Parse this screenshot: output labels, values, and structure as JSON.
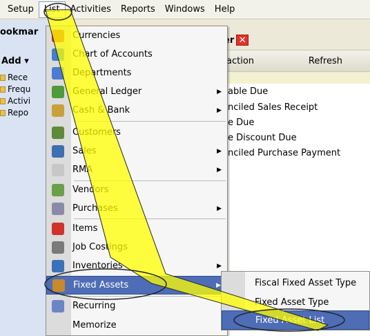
{
  "menubar": {
    "items": [
      {
        "label": "Setup"
      },
      {
        "label": "List"
      },
      {
        "label": "Activities"
      },
      {
        "label": "Reports"
      },
      {
        "label": "Windows"
      },
      {
        "label": "Help"
      }
    ],
    "active_index": 1
  },
  "bookmarks": {
    "title": "ookmar",
    "add_label": "Add ▾",
    "items": [
      "Rece",
      "Frequ",
      "Activi",
      "Repo"
    ]
  },
  "right_panel": {
    "title": "er",
    "close_glyph": "✕",
    "toolbar": [
      "action",
      "Refresh"
    ],
    "lines": [
      "able Due",
      "nciled Sales Receipt",
      "e Due",
      "e Discount Due",
      "nciled Purchase Payment"
    ]
  },
  "list_menu": {
    "items": [
      {
        "label": "Currencies",
        "icon": "currency-icon",
        "color": "#d33b2c"
      },
      {
        "label": "Chart of Accounts",
        "icon": "chart-of-accounts-icon",
        "color": "#3f7fce"
      },
      {
        "label": "Departments",
        "icon": "departments-icon",
        "color": "#4b7bd3"
      },
      {
        "label": "General Ledger",
        "icon": "general-ledger-icon",
        "color": "#4f9a3a",
        "submenu": true
      },
      {
        "label": "Cash & Bank",
        "icon": "cash-bank-icon",
        "color": "#c9a13a",
        "submenu": true
      },
      {
        "label": "Customers",
        "icon": "customers-icon",
        "color": "#5f8a3c"
      },
      {
        "label": "Sales",
        "icon": "sales-icon",
        "color": "#3f6fb0",
        "submenu": true
      },
      {
        "label": "RMA",
        "icon": "rma-icon",
        "color": "#c7c7c7",
        "submenu": true
      },
      {
        "label": "Vendors",
        "icon": "vendors-icon",
        "color": "#6aa048"
      },
      {
        "label": "Purchases",
        "icon": "purchases-icon",
        "color": "#8a8aa8",
        "submenu": true
      },
      {
        "label": "Items",
        "icon": "items-icon",
        "color": "#d0332a"
      },
      {
        "label": "Job Costings",
        "icon": "job-costings-icon",
        "color": "#7a7a7a"
      },
      {
        "label": "Inventories",
        "icon": "inventories-icon",
        "color": "#3a72b8",
        "submenu": true
      },
      {
        "label": "Fixed Assets",
        "icon": "fixed-assets-icon",
        "color": "#c78a2a",
        "submenu": true
      },
      {
        "label": "Recurring",
        "icon": "recurring-icon",
        "color": "#6d85c6"
      },
      {
        "label": "Memorize",
        "icon": "",
        "color": ""
      }
    ],
    "highlight_index": 13
  },
  "fixed_assets_submenu": {
    "items": [
      {
        "label": "Fiscal Fixed Asset Type"
      },
      {
        "label": "Fixed Asset Type"
      },
      {
        "label": "Fixed Asset List"
      }
    ],
    "highlight_index": 2
  },
  "colors": {
    "highlight": "#4e6db6",
    "annotation": "#ffff00"
  }
}
